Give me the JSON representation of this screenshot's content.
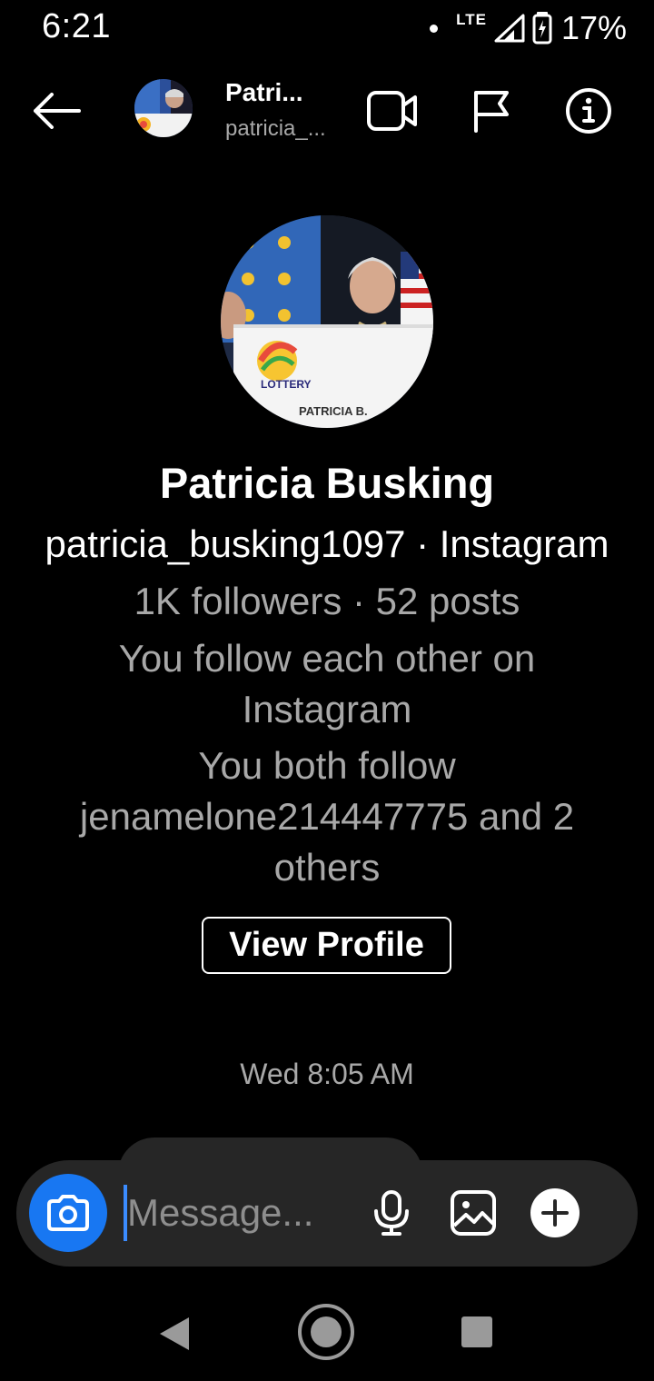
{
  "status_bar": {
    "time": "6:21",
    "network": "LTE",
    "battery_percent": "17%",
    "icons": [
      "notification-dot-icon",
      "signal-icon",
      "battery-charging-icon"
    ]
  },
  "header": {
    "name": "Patri...",
    "username": "patricia_...",
    "icons": [
      "back-arrow-icon",
      "video-call-icon",
      "flag-icon",
      "info-icon"
    ]
  },
  "profile": {
    "name": "Patricia Busking",
    "handle": "patricia_busking1097 · Instagram",
    "stats": "1K followers · 52 posts",
    "mutual_follow": "You follow each other on Instagram",
    "mutual_friends": "You both follow jenamelone214447775 and 2 others",
    "photo_caption": "PATRICIA B.",
    "photo_logo_text": "LOTTERY",
    "view_profile_label": "View Profile"
  },
  "thread": {
    "timestamp": "Wed 8:05 AM"
  },
  "composer": {
    "placeholder": "Message...",
    "icons": [
      "camera-icon",
      "microphone-icon",
      "gallery-icon",
      "plus-icon"
    ]
  },
  "nav_bar": {
    "icons": [
      "nav-back-icon",
      "nav-home-icon",
      "nav-recents-icon"
    ]
  },
  "colors": {
    "background": "#000000",
    "accent_blue": "#1877f2",
    "secondary_text": "#a8a8a8",
    "composer_bg": "#262626"
  }
}
